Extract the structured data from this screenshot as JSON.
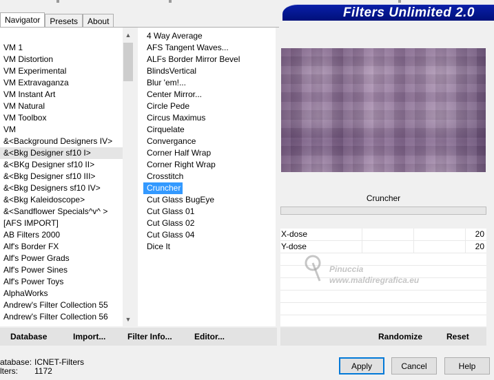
{
  "banner": {
    "title": "Filters Unlimited 2.0"
  },
  "tabs": [
    {
      "label": "Navigator",
      "active": true
    },
    {
      "label": "Presets",
      "active": false
    },
    {
      "label": "About",
      "active": false
    }
  ],
  "categories": [
    "VM 1",
    "VM Distortion",
    "VM Experimental",
    "VM Extravaganza",
    "VM Instant Art",
    "VM Natural",
    "VM Toolbox",
    "VM",
    "&<Background Designers IV>",
    "&<Bkg Designer sf10 I>",
    "&<BKg Designer sf10 II>",
    "&<Bkg Designer sf10 III>",
    "&<Bkg Designers sf10 IV>",
    "&<Bkg Kaleidoscope>",
    "&<Sandflower Specials^v^ >",
    "[AFS IMPORT]",
    "AB Filters 2000",
    "Alf's Border FX",
    "Alf's Power Grads",
    "Alf's Power Sines",
    "Alf's Power Toys",
    "AlphaWorks",
    "Andrew's Filter Collection 55",
    "Andrew's Filter Collection 56"
  ],
  "highlighted_category": "&<Bkg Designer sf10 I>",
  "filters": [
    "4 Way Average",
    "AFS Tangent Waves...",
    "ALFs Border Mirror Bevel",
    "BlindsVertical",
    "Blur 'em!...",
    "Center Mirror...",
    "Circle Pede",
    "Circus Maximus",
    "Cirquelate",
    "Convergance",
    "Corner Half Wrap",
    "Corner Right Wrap",
    "Crosstitch",
    "Cruncher",
    "Cut Glass  BugEye",
    "Cut Glass 01",
    "Cut Glass 02",
    "Cut Glass 04",
    "Dice It"
  ],
  "selected_filter": "Cruncher",
  "filter_name": "Cruncher",
  "params": [
    {
      "label": "X-dose",
      "value": "20"
    },
    {
      "label": "Y-dose",
      "value": "20"
    }
  ],
  "watermark": {
    "name": "Pinuccia",
    "url": "www.maldiregrafica.eu"
  },
  "left_buttons": {
    "database": "Database",
    "import": "Import...",
    "filter_info": "Filter Info...",
    "editor": "Editor..."
  },
  "right_buttons": {
    "randomize": "Randomize",
    "reset": "Reset"
  },
  "status": {
    "database_label": "atabase:",
    "database_value": "ICNET-Filters",
    "filters_label": "lters:",
    "filters_value": "1172"
  },
  "dialog_buttons": {
    "apply": "Apply",
    "cancel": "Cancel",
    "help": "Help"
  }
}
